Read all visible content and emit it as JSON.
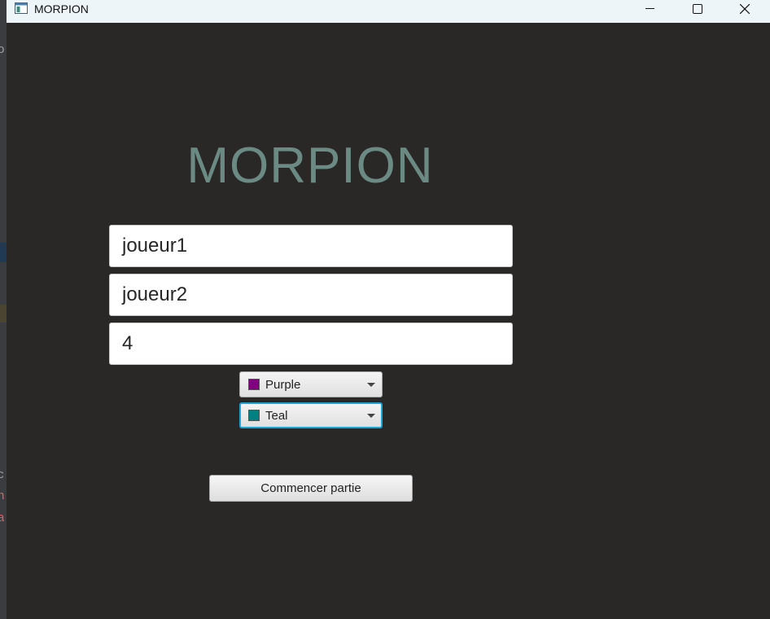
{
  "window": {
    "title": "MORPION",
    "controls": [
      "minimize",
      "maximize",
      "close"
    ]
  },
  "background_strip": {
    "glyphs": [
      "o",
      "c",
      "n",
      "a"
    ]
  },
  "main": {
    "heading": "MORPION",
    "player1_value": "joueur1",
    "player2_value": "joueur2",
    "size_value": "4",
    "color1": {
      "label": "Purple",
      "swatch": "#800080"
    },
    "color2": {
      "label": "Teal",
      "swatch": "#008080"
    },
    "start_button": "Commencer partie"
  },
  "colors": {
    "background": "#2a2826",
    "heading": "#6b8a84",
    "focus_ring": "#1aa6d6",
    "titlebar": "#eef5f9"
  }
}
